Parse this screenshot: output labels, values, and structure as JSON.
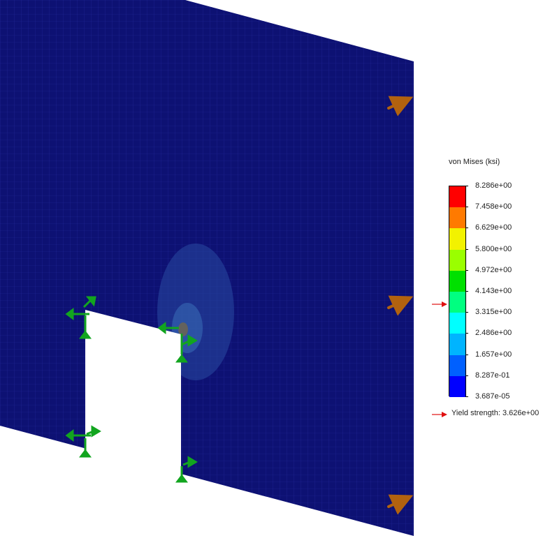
{
  "legend": {
    "title": "von Mises (ksi)",
    "labels": [
      "8.286e+00",
      "7.458e+00",
      "6.629e+00",
      "5.800e+00",
      "4.972e+00",
      "4.143e+00",
      "3.315e+00",
      "2.486e+00",
      "1.657e+00",
      "8.287e-01",
      "3.687e-05"
    ],
    "colors": [
      "#ff0000",
      "#ff7a00",
      "#f2f200",
      "#9aff00",
      "#00e000",
      "#00ff80",
      "#00ffff",
      "#00b4ff",
      "#0060ff",
      "#0000ff"
    ],
    "yield_strength_label": "Yield strength: 3.626e+00",
    "yield_value": 3.626,
    "max_value": 8.286,
    "min_value": 3.687e-05
  },
  "colors": {
    "mesh": "#0d1173",
    "mesh_lines": "#23299a",
    "fixture": "#12a51f",
    "load": "#b2620f",
    "marker": "#e01010"
  }
}
